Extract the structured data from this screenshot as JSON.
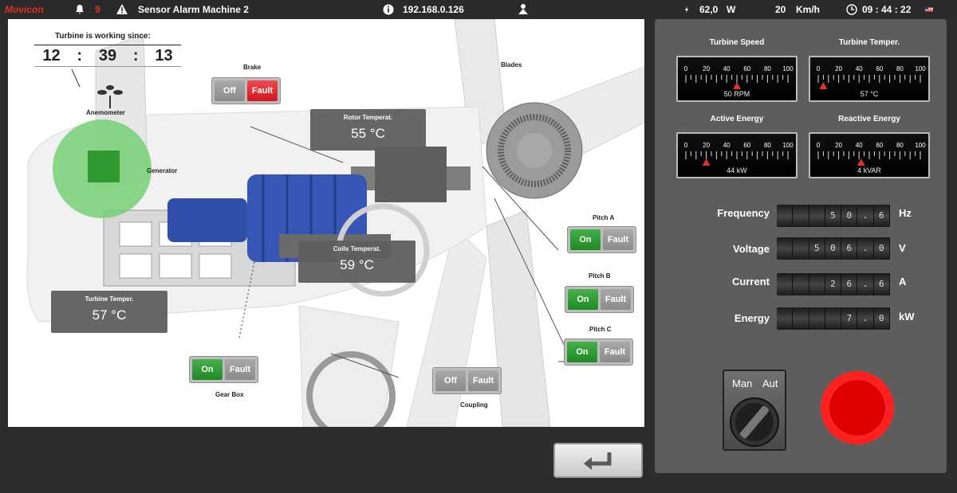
{
  "topbar": {
    "app_name": "Movicon",
    "alarm_count": "9",
    "alarm_title": "Sensor Alarm Machine 2",
    "ip": "192.168.0.126",
    "power_value": "62,0",
    "power_unit": "W",
    "speed_value": "20",
    "speed_unit": "Km/h",
    "time": "09 : 44 : 22"
  },
  "scene": {
    "working_since_label": "Turbine is working since:",
    "working_hh": "12",
    "working_mm": "39",
    "working_ss": "13",
    "sep": ":",
    "anemometer": "Anemometer",
    "generator": "Generator",
    "brake": {
      "label": "Brake",
      "off": "Off",
      "fault": "Fault"
    },
    "blades": "Blades",
    "rotor_temp": {
      "title": "Rotor Temperat.",
      "value": "55 °C"
    },
    "coils_temp": {
      "title": "Coils Temperat.",
      "value": "59 °C"
    },
    "turbine_temp": {
      "title": "Turbine Temper.",
      "value": "57 °C"
    },
    "pitch_a": {
      "label": "Pitch  A",
      "on": "On",
      "fault": "Fault"
    },
    "pitch_b": {
      "label": "Pitch  B",
      "on": "On",
      "fault": "Fault"
    },
    "pitch_c": {
      "label": "Pitch  C",
      "on": "On",
      "fault": "Fault"
    },
    "gearbox": {
      "label": "Gear Box",
      "on": "On",
      "fault": "Fault"
    },
    "coupling": {
      "label": "Coupling",
      "off": "Off",
      "fault": "Fault"
    }
  },
  "gauges": [
    {
      "title": "Turbine Speed",
      "value_text": "50 RPM",
      "value": 50
    },
    {
      "title": "Turbine Temper.",
      "value_text": "57 °C",
      "value": 5
    },
    {
      "title": "Active Energy",
      "value_text": "44 kW",
      "value": 20
    },
    {
      "title": "Reactive Energy",
      "value_text": "4 kVAR",
      "value": 42
    }
  ],
  "gauge_ticks": [
    "0",
    "20",
    "40",
    "60",
    "80",
    "100"
  ],
  "measures": [
    {
      "label": "Frequency",
      "digits": [
        "",
        "",
        "",
        "5",
        "0",
        ".",
        "6"
      ],
      "unit": "Hz"
    },
    {
      "label": "Voltage",
      "digits": [
        "",
        "",
        "5",
        "0",
        "6",
        ".",
        "0"
      ],
      "unit": "V"
    },
    {
      "label": "Current",
      "digits": [
        "",
        "",
        "",
        "2",
        "6",
        ".",
        "6"
      ],
      "unit": "A"
    },
    {
      "label": "Energy",
      "digits": [
        "",
        "",
        "",
        "",
        "7",
        ".",
        "0"
      ],
      "unit": "kW"
    }
  ],
  "selector": {
    "man": "Man",
    "aut": "Aut"
  },
  "colors": {
    "on": "#1e8a24",
    "fault": "#d01820",
    "estop": "#e00000",
    "glow": "#6fd06f"
  }
}
